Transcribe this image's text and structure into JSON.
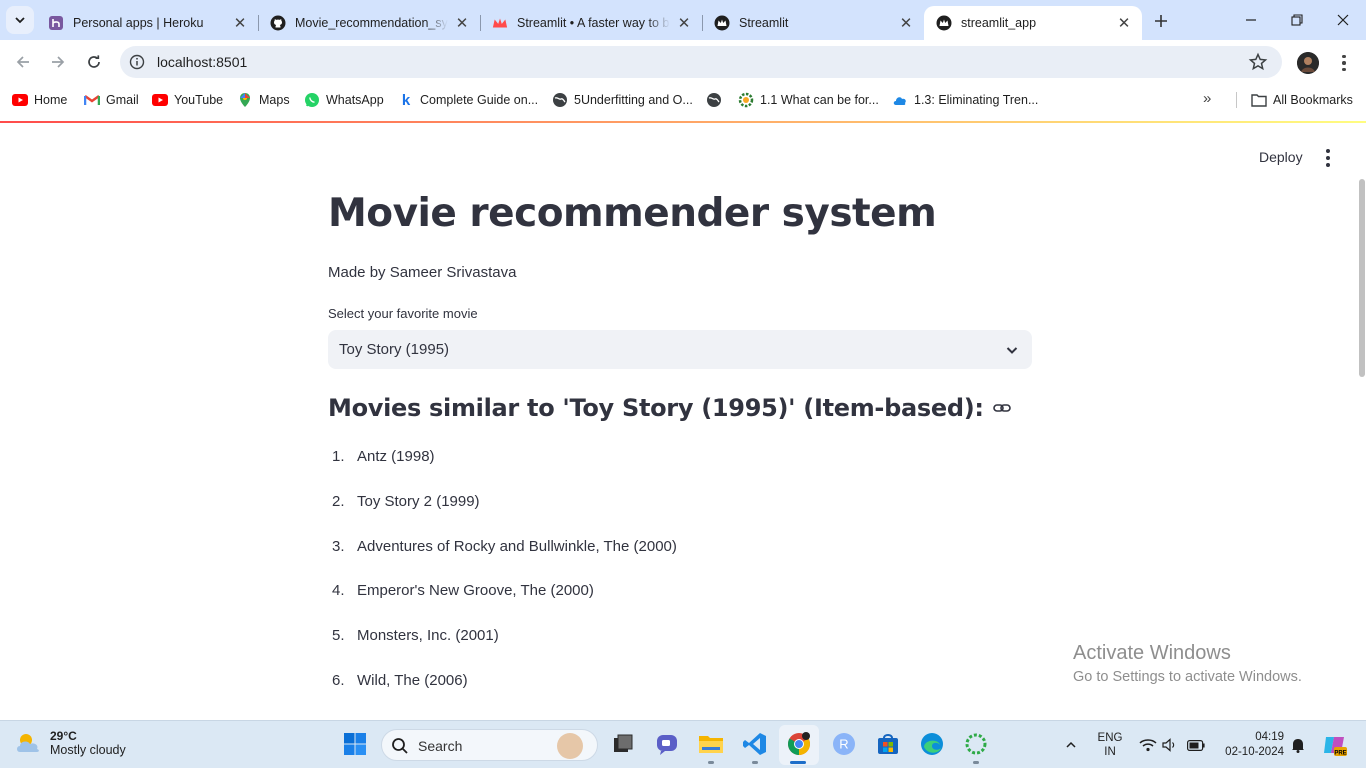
{
  "browser": {
    "tabs": [
      {
        "title": "Personal apps | Heroku",
        "favicon": "heroku-icon"
      },
      {
        "title": "Movie_recommendation_system",
        "favicon": "github-icon"
      },
      {
        "title": "Streamlit • A faster way to build and share data apps",
        "favicon": "streamlit-crown-icon"
      },
      {
        "title": "Streamlit",
        "favicon": "streamlit-icon"
      },
      {
        "title": "streamlit_app",
        "favicon": "streamlit-icon",
        "active": true
      }
    ],
    "url": "localhost:8501",
    "bookmarks": [
      {
        "label": "Home",
        "icon": "youtube-icon"
      },
      {
        "label": "Gmail",
        "icon": "gmail-icon"
      },
      {
        "label": "YouTube",
        "icon": "youtube-icon"
      },
      {
        "label": "Maps",
        "icon": "maps-icon"
      },
      {
        "label": "WhatsApp",
        "icon": "whatsapp-icon"
      },
      {
        "label": "Complete Guide on...",
        "icon": "k-icon"
      },
      {
        "label": "5Underfitting and O...",
        "icon": "globe-icon"
      },
      {
        "label": "",
        "icon": "globe-icon"
      },
      {
        "label": "1.1 What can be for...",
        "icon": "gear-icon"
      },
      {
        "label": "1.3: Eliminating Tren...",
        "icon": "cloud-icon"
      }
    ],
    "all_bookmarks_label": "All Bookmarks"
  },
  "app": {
    "deploy_label": "Deploy",
    "title": "Movie recommender system",
    "byline": "Made by Sameer Srivastava",
    "select_label": "Select your favorite movie",
    "selected_movie": "Toy Story (1995)",
    "results_heading": "Movies similar to 'Toy Story (1995)' (Item-based):",
    "recommendations": [
      {
        "num": "1.",
        "title": "Antz (1998)"
      },
      {
        "num": "2.",
        "title": "Toy Story 2 (1999)"
      },
      {
        "num": "3.",
        "title": "Adventures of Rocky and Bullwinkle, The (2000)"
      },
      {
        "num": "4.",
        "title": "Emperor's New Groove, The (2000)"
      },
      {
        "num": "5.",
        "title": "Monsters, Inc. (2001)"
      },
      {
        "num": "6.",
        "title": "Wild, The (2006)"
      }
    ]
  },
  "watermark": {
    "line1": "Activate Windows",
    "line2": "Go to Settings to activate Windows."
  },
  "taskbar": {
    "weather_temp": "29°C",
    "weather_desc": "Mostly cloudy",
    "search_placeholder": "Search",
    "lang_line1": "ENG",
    "lang_line2": "IN",
    "time": "04:19",
    "date": "02-10-2024"
  },
  "colors": {
    "tabstrip": "#d3e3fd",
    "text": "#31333f",
    "select_bg": "#f0f2f6",
    "accent_red": "#ff4b4b"
  }
}
